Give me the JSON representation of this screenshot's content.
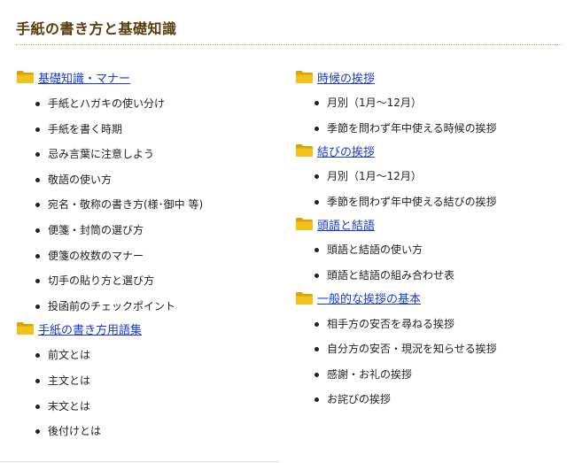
{
  "page": {
    "title": "手紙の書き方と基礎知識"
  },
  "left_sections": [
    {
      "title": "基礎知識・マナー",
      "items": [
        "手紙とハガキの使い分け",
        "手紙を書く時期",
        "忌み言葉に注意しよう",
        "敬語の使い方",
        "宛名・敬称の書き方(様･御中 等)",
        "便箋・封筒の選び方",
        "便箋の枚数のマナー",
        "切手の貼り方と選び方",
        "投函前のチェックポイント"
      ]
    },
    {
      "title": "手紙の書き方用語集",
      "items": [
        "前文とは",
        "主文とは",
        "末文とは",
        "後付けとは"
      ]
    }
  ],
  "right_sections": [
    {
      "title": "時候の挨拶",
      "items": [
        "月別（1月～12月）",
        "季節を問わず年中使える時候の挨拶"
      ]
    },
    {
      "title": "結びの挨拶",
      "items": [
        "月別（1月～12月）",
        "季節を問わず年中使える結びの挨拶"
      ]
    },
    {
      "title": "頭語と結語",
      "items": [
        "頭語と結語の使い方",
        "頭語と結語の組み合わせ表"
      ]
    },
    {
      "title": "一般的な挨拶の基本",
      "items": [
        "相手方の安否を尋ねる挨拶",
        "自分方の安否・現況を知らせる挨拶",
        "感謝・お礼の挨拶",
        "お詫びの挨拶"
      ]
    }
  ],
  "icons": {
    "section": "folder-icon"
  },
  "colors": {
    "folder": "#e8b400",
    "link": "#1a3ad6",
    "title": "#5a3d0a"
  }
}
